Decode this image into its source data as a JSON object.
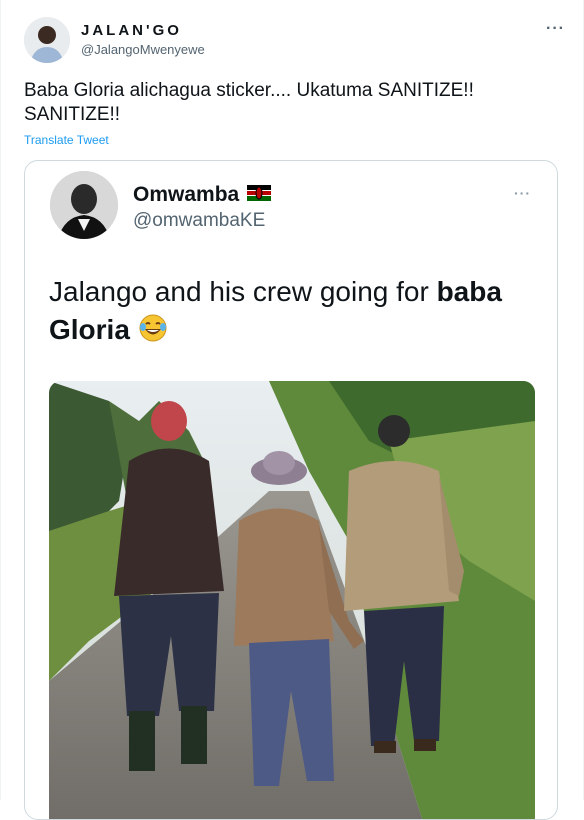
{
  "author": {
    "name": "JALAN'GO",
    "handle": "@JalangoMwenyewe"
  },
  "tweet": {
    "text": "Baba Gloria alichagua sticker.... Ukatuma SANITIZE!! SANITIZE!!",
    "translate_label": "Translate Tweet",
    "more_label": "···"
  },
  "quoted": {
    "name": "Omwamba",
    "handle": "@omwambaKE",
    "text_prefix": "Jalango and his crew going for ",
    "text_bold": "baba Gloria",
    "flag_icon": "kenya-flag-icon",
    "emoji_icon": "tears-of-joy-emoji",
    "more_label": "···"
  },
  "colors": {
    "link": "#1d9bf0",
    "secondary_text": "#536471",
    "border": "#cfd9de"
  }
}
